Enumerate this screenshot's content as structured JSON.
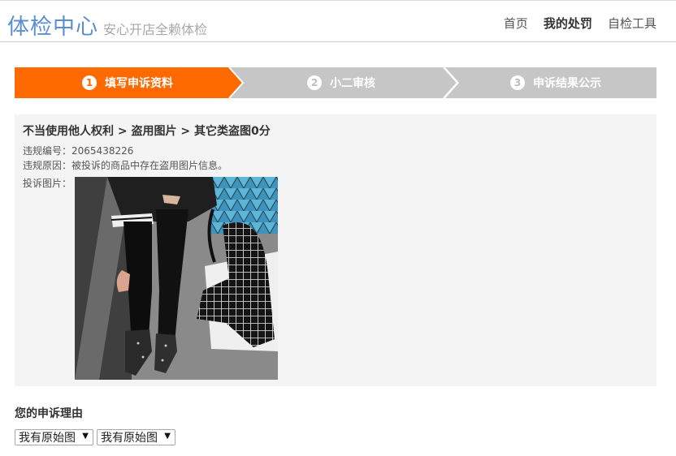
{
  "header": {
    "title": "体检中心",
    "slogan": "安心开店全赖体检",
    "nav": [
      {
        "label": "首页",
        "active": false
      },
      {
        "label": "我的处罚",
        "active": true
      },
      {
        "label": "自检工具",
        "active": false
      }
    ]
  },
  "steps": [
    {
      "num": "1",
      "label": "填写申诉资料",
      "active": true
    },
    {
      "num": "2",
      "label": "小二审核",
      "active": false
    },
    {
      "num": "3",
      "label": "申诉结果公示",
      "active": false
    }
  ],
  "violation": {
    "title": "不当使用他人权利 > 盗用图片 > 其它类盗图0分",
    "id_label": "违规编号：",
    "id_value": "2065438226",
    "reason_label": "违规原因：",
    "reason_value": "被投诉的商品中存在盗用图片信息。",
    "image_label": "投诉图片："
  },
  "appeal": {
    "title": "您的申诉理由",
    "select1": "我有原始图",
    "select2": "我有原始图"
  },
  "colors": {
    "accent": "#ff6a00",
    "step_inactive": "#c6c6c6",
    "brand": "#5b8fd2",
    "panel_bg": "#f4f4f4"
  },
  "icons": {
    "dropdown": "caret-down-icon"
  }
}
